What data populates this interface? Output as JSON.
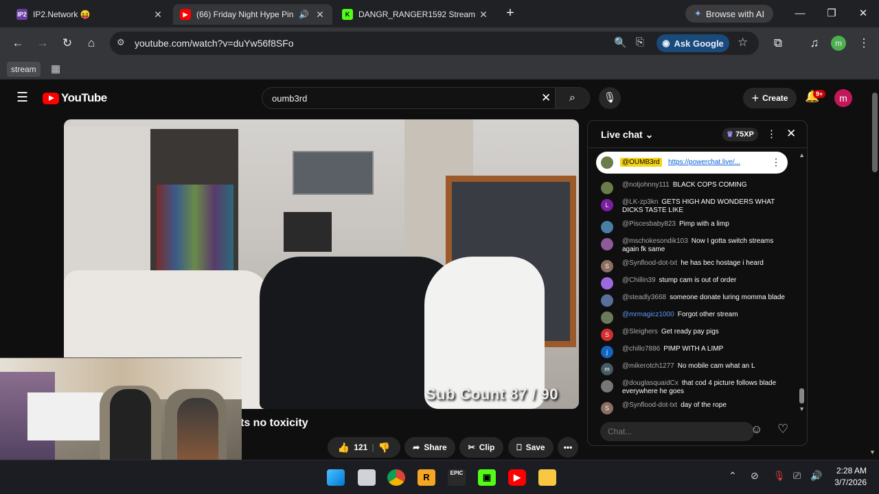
{
  "browser": {
    "tabs": [
      {
        "title": "IP2.Network 😝",
        "favicon": "IP2"
      },
      {
        "title": "(66) Friday Night Hype Pint",
        "favicon": "yt"
      },
      {
        "title": "DANGR_RANGER1592 Stream -",
        "favicon": "K"
      }
    ],
    "browse_ai": "Browse with AI",
    "url": "youtube.com/watch?v=duYw56f8SFo",
    "ask_google": "Ask Google",
    "profile_initial": "m",
    "bookmark": "stream"
  },
  "youtube": {
    "logo_text": "YouTube",
    "search_value": "oumb3rd",
    "create_label": "Create",
    "notif_count": "9+",
    "avatar_initial": "m",
    "video": {
      "overlay_text": "Sub Count  87 / 90",
      "title_fragment": "ts no toxicity"
    },
    "actions": {
      "like_count": "121",
      "share": "Share",
      "clip": "Clip",
      "save": "Save"
    },
    "chat": {
      "title": "Live chat",
      "xp": "75XP",
      "pinned_user": "@OUMB3rd",
      "pinned_link": "https://powerchat.live/...",
      "input_placeholder": "Chat...",
      "messages": [
        {
          "user": "@notjohnny111",
          "text": "BLACK COPS COMING",
          "avatar": "",
          "color": "#6b7c4a"
        },
        {
          "user": "@LK-zp3kn",
          "text": "GETS HIGH AND WONDERS WHAT DICKS TASTE LIKE",
          "avatar": "L",
          "color": "#7b1fa2"
        },
        {
          "user": "@Piscesbaby823",
          "text": "Pimp with a limp",
          "avatar": "",
          "color": "#4a7fa5"
        },
        {
          "user": "@mschokesondik103",
          "text": "Now I gotta switch streams again fk same",
          "avatar": "",
          "color": "#8e5a9a"
        },
        {
          "user": "@Synflood-dot-txt",
          "text": "he has bec hostage i heard",
          "avatar": "S",
          "color": "#8d6e63"
        },
        {
          "user": "@Chillin39",
          "text": "stump cam is out of order",
          "avatar": "",
          "color": "#9c6ade"
        },
        {
          "user": "@steadly3668",
          "text": "someone donate luring momma blade",
          "avatar": "",
          "color": "#5a6e9a"
        },
        {
          "user": "@mrmagicz1000",
          "text": "Forgot other stream",
          "avatar": "",
          "color": "#6a7a5a",
          "blue": true
        },
        {
          "user": "@Sleighers",
          "text": "Get ready pay pigs",
          "avatar": "S",
          "color": "#d32f2f"
        },
        {
          "user": "@chillo7886",
          "text": "PIMP WITH A LIMP",
          "avatar": "j",
          "color": "#1565c0"
        },
        {
          "user": "@mikerotch1277",
          "text": "No mobile cam what an L",
          "avatar": "m",
          "color": "#455a64"
        },
        {
          "user": "@douglasquaidCx",
          "text": "that cod 4 picture follows blade everywhere he goes",
          "avatar": "",
          "color": "#777777"
        },
        {
          "user": "@Synflood-dot-txt",
          "text": "day of the rope",
          "avatar": "S",
          "color": "#8d6e63"
        }
      ]
    }
  },
  "taskbar": {
    "time": "2:28 AM",
    "date": "3/7/2026"
  }
}
